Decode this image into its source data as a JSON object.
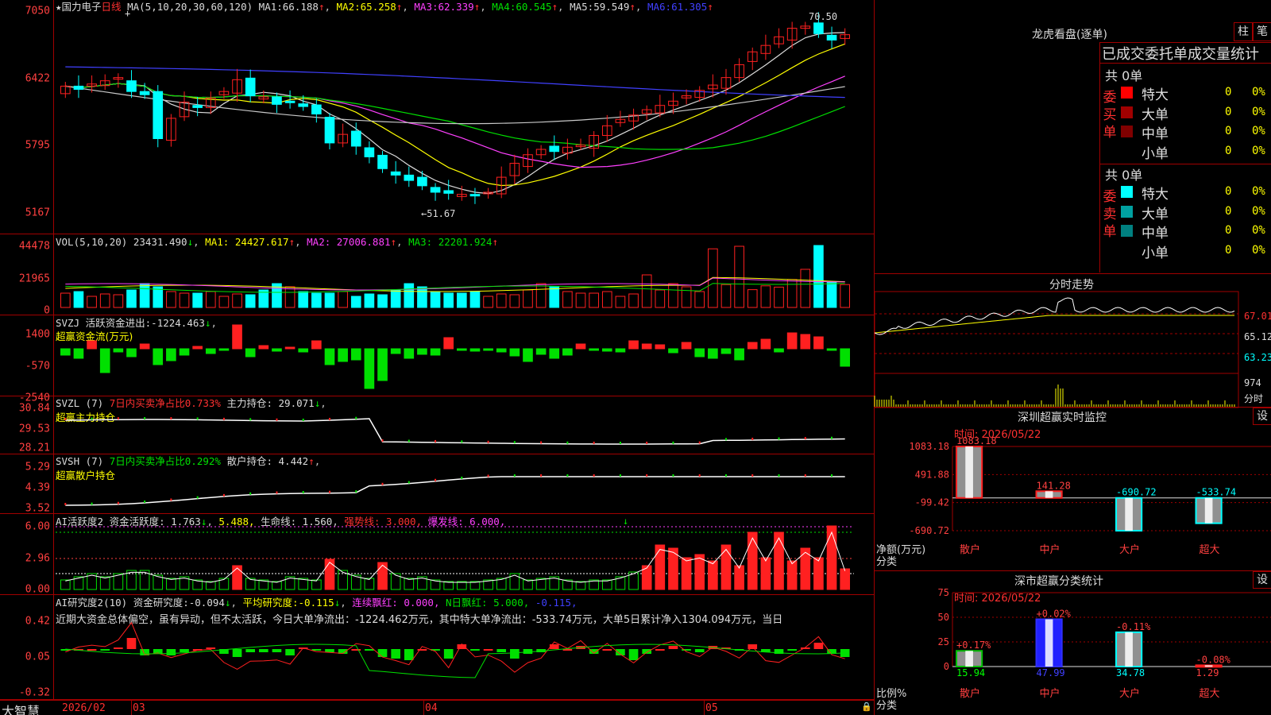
{
  "stock": {
    "name": "国力电子",
    "period": "日线",
    "ma_params": "MA(5,10,20,30,60,120)",
    "ma": [
      {
        "label": "MA1:",
        "value": "66.188"
      },
      {
        "label": "MA2:",
        "value": "65.258"
      },
      {
        "label": "MA3:",
        "value": "62.339"
      },
      {
        "label": "MA4:",
        "value": "60.545"
      },
      {
        "label": "MA5:",
        "value": "59.549"
      },
      {
        "label": "MA6:",
        "value": "61.305"
      }
    ],
    "high_label": "70.50",
    "low_label": "51.67",
    "yticks": [
      "7050",
      "6422",
      "5795",
      "5167"
    ]
  },
  "vol": {
    "params": "VOL(5,10,20)",
    "value": "23431.490",
    "ma1": "24427.617",
    "ma2": "27006.881",
    "ma3": "22201.924",
    "yticks": [
      "44478",
      "21965",
      "0"
    ]
  },
  "svzj": {
    "name": "SVZJ",
    "label": "活跃资金进出:",
    "value": "-1224.463",
    "title": "超赢资金流(万元)",
    "yticks": [
      "1400",
      "-570",
      "-2540"
    ]
  },
  "svzl": {
    "name": "SVZL (7)",
    "ratio_label": "7日内买卖净占比0.733%",
    "hold_label": "主力持仓:",
    "hold": "29.071",
    "title": "超赢主力持仓",
    "yticks": [
      "30.84",
      "29.53",
      "28.21"
    ]
  },
  "svsh": {
    "name": "SVSH (7)",
    "ratio_label": "7日内买卖净占比0.292%",
    "hold_label": "散户持仓:",
    "hold": "4.442",
    "title": "超赢散户持仓",
    "yticks": [
      "5.29",
      "4.39",
      "3.52"
    ]
  },
  "ai1": {
    "name": "AI活跃度2",
    "label": "资金活跃度:",
    "value": "1.763",
    "v2": "5.488",
    "life_label": "生命线:",
    "life": "1.560",
    "strong": "强势线: 3.000",
    "burst": "爆发线: 6.000",
    "yticks": [
      "6.00",
      "2.96",
      "0.00"
    ]
  },
  "ai2": {
    "name": "AI研究度2(10)",
    "label": "资金研究度:",
    "value": "-0.094",
    "avg_label": "平均研究度:",
    "avg": "-0.115",
    "lh": "连续飘红: 0.000",
    "nh": "N日飘红: 5.000",
    "v5": "-0.115",
    "text": "近期大资金总体偏空，虽有异动，但不太活跃，今日大单净流出：-1224.462万元，其中特大单净流出：-533.74万元，大单5日累计净入1304.094万元，当日",
    "yticks": [
      "0.42",
      "0.05",
      "-0.32"
    ]
  },
  "xaxis": {
    "labels": [
      "2026/02",
      "03",
      "04",
      "05"
    ]
  },
  "brand": "大智慧",
  "lhb": {
    "title": "龙虎看盘(逐单)",
    "btn1": "柱",
    "btn2": "笔",
    "heading": "已成交委托单成交量统计",
    "buy_side": "委买单",
    "sell_side": "委卖单",
    "total_buy": "共 0单",
    "total_sell": "共 0单",
    "rows_buy": [
      {
        "label": "特大",
        "count": "0",
        "pct": "0%",
        "color": "#ff0000"
      },
      {
        "label": "大单",
        "count": "0",
        "pct": "0%",
        "color": "#a00000"
      },
      {
        "label": "中单",
        "count": "0",
        "pct": "0%",
        "color": "#800000"
      },
      {
        "label": "小单",
        "count": "0",
        "pct": "0%",
        "color": ""
      }
    ],
    "rows_sell": [
      {
        "label": "特大",
        "count": "0",
        "pct": "0%",
        "color": "#00ffff"
      },
      {
        "label": "大单",
        "count": "0",
        "pct": "0%",
        "color": "#00a0a0"
      },
      {
        "label": "中单",
        "count": "0",
        "pct": "0%",
        "color": "#008080"
      },
      {
        "label": "小单",
        "count": "0",
        "pct": "0%",
        "color": ""
      }
    ]
  },
  "fenshi": {
    "title": "分时走势",
    "yticks": [
      "67.01",
      "65.12",
      "63.23"
    ],
    "vol_ticks": [
      "974",
      "分时"
    ]
  },
  "sz_monitor": {
    "title": "深圳超赢实时监控",
    "btn": "设",
    "time": "时间: 2026/05/22",
    "unit": "净额(万元)",
    "cat_label": "分类",
    "yticks": [
      "1083.18",
      "491.88",
      "-99.42",
      "-690.72"
    ],
    "chart_data": {
      "type": "bar",
      "categories": [
        "散户",
        "中户",
        "大户",
        "超大"
      ],
      "values": [
        1083.18,
        141.28,
        -690.72,
        -533.74
      ],
      "ylim": [
        -690.72,
        1083.18
      ]
    }
  },
  "sz_class": {
    "title": "深市超赢分类统计",
    "btn": "设",
    "time": "时间: 2026/05/22",
    "unit": "比例%",
    "cat_label": "分类",
    "yticks": [
      "75",
      "50",
      "25",
      "0"
    ],
    "chart_data": {
      "type": "bar",
      "categories": [
        "散户",
        "中户",
        "大户",
        "超大"
      ],
      "values": [
        15.94,
        47.99,
        34.78,
        1.29
      ],
      "changes": [
        "+0.17%",
        "+0.02%",
        "-0.11%",
        "-0.08%"
      ],
      "ylim": [
        0,
        75
      ]
    }
  },
  "chart_data": {
    "type": "candlestick",
    "title": "国力电子 日线",
    "ylim": [
      51.67,
      70.5
    ],
    "categories": [
      "2026/02",
      "03",
      "04",
      "05"
    ],
    "series": [
      {
        "name": "MA1",
        "value": 66.188
      },
      {
        "name": "MA2",
        "value": 65.258
      },
      {
        "name": "MA3",
        "value": 62.339
      },
      {
        "name": "MA4",
        "value": 60.545
      },
      {
        "name": "MA5",
        "value": 59.549
      },
      {
        "name": "MA6",
        "value": 61.305
      }
    ]
  },
  "colors": {
    "up": "#ff2020",
    "down": "#00ffff",
    "grid": "#a00000"
  }
}
